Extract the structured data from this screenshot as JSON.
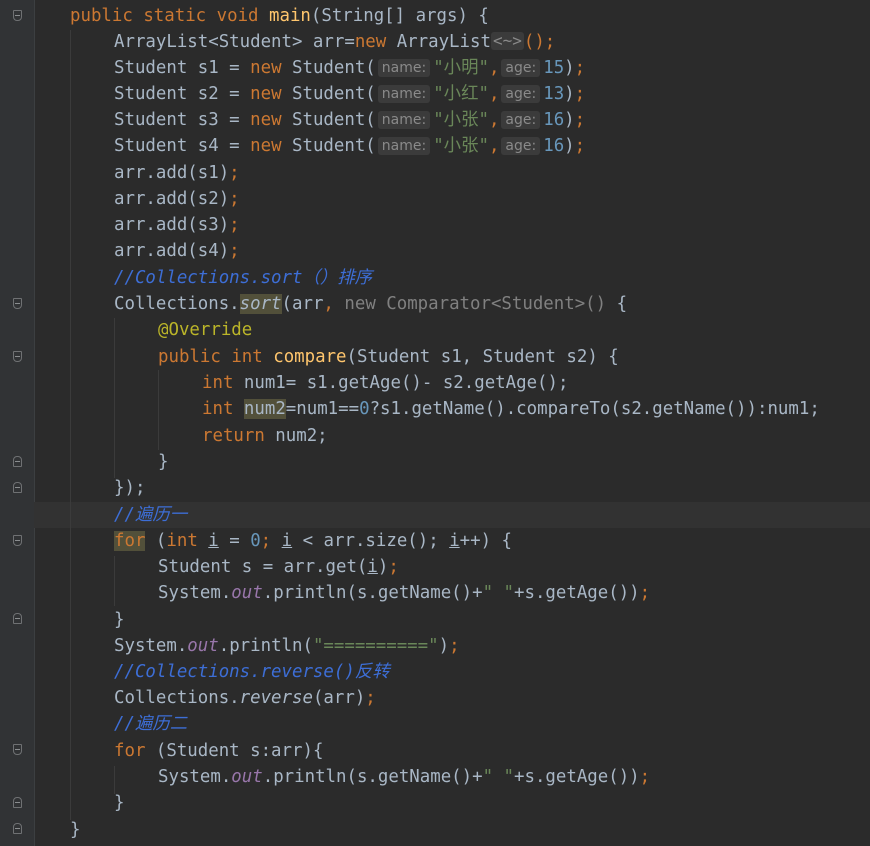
{
  "editor": {
    "language": "java",
    "lines": {
      "main_sig": [
        "public",
        " ",
        "static",
        " ",
        "void",
        " ",
        "main",
        "(String[] args) {"
      ],
      "arraylist_type": "ArrayList<Student> arr=",
      "kw_new": "new",
      "arraylist_ctor": " ArrayList",
      "diamond_hint": "<~>",
      "parens_semi": "();",
      "students": [
        {
          "decl": "Student s1 = ",
          "name": "\"小明\"",
          "age": "15"
        },
        {
          "decl": "Student s2 = ",
          "name": "\"小红\"",
          "age": "13"
        },
        {
          "decl": "Student s3 = ",
          "name": "\"小张\"",
          "age": "16"
        },
        {
          "decl": "Student s4 = ",
          "name": "\"小张\"",
          "age": "16"
        }
      ],
      "hint_name": "name:",
      "hint_age": "age:",
      "ctor_name": " Student(",
      "adds": [
        "arr.add(s1)",
        "arr.add(s2)",
        "arr.add(s3)",
        "arr.add(s4)"
      ],
      "comment_sort": "//Collections.sort（）排序",
      "collections": "Collections.",
      "sort": "sort",
      "sort_rest_a": "(arr",
      "sort_rest_b": " new Comparator<Student>()",
      "sort_rest_c": " {",
      "override": "@Override",
      "compare_sig_a": "public",
      "compare_sig_b": "int",
      "compare_fn": "compare",
      "compare_params": "(Student s1, Student s2) {",
      "num1_line": " num1= s1.getAge()- s2.getAge();",
      "kw_int": "int",
      "num2_var": "num2",
      "num2_rest_a": "=num1==",
      "zero": "0",
      "num2_rest_b": "?s1.getName().compareTo(s2.getName()):num1;",
      "kw_return": "return",
      "return_rest": " num2;",
      "close_brace": "}",
      "close_paren": "});",
      "comment_loop1": "//遍历一",
      "kw_for": "for",
      "for1_a": " (",
      "for1_int": "int",
      "for1_i": "i",
      "for1_b": " = ",
      "for1_c": "; ",
      "for1_d": " < arr.size(); ",
      "for1_e": "++) {",
      "get_line_a": "Student s = arr.get(",
      "get_line_b": ");",
      "sysout_a": "System.",
      "sysout_out": "out",
      "sysout_b": ".println(s.getName()+",
      "space_str": "\" \"",
      "sysout_c": "+s.getAge());",
      "sep_a": ".println(",
      "sep_str": "\"==========\"",
      "sep_b": ");",
      "comment_reverse": "//Collections.reverse()反转",
      "reverse": "reverse",
      "reverse_rest": "(arr);",
      "comment_loop2": "//遍历二",
      "for2_rest": " (Student s:arr){",
      "final_brace": "}"
    }
  }
}
